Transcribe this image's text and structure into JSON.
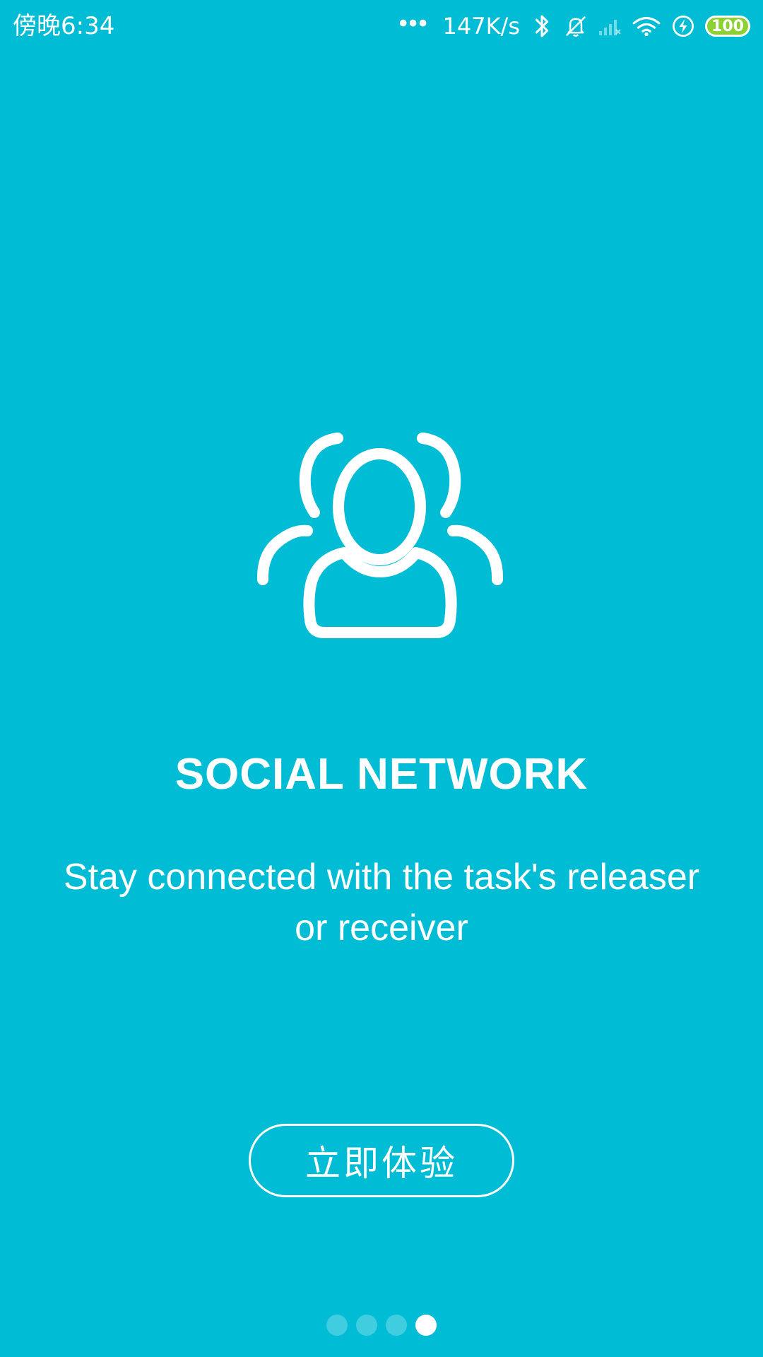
{
  "status_bar": {
    "time": "傍晚6:34",
    "more_indicator": "•••",
    "network_speed": "147K/s",
    "battery_level": "100",
    "battery_color": "#8bd12f",
    "icons": [
      "bluetooth-icon",
      "alarm-off-icon",
      "signal-icon",
      "wifi-icon",
      "charging-icon",
      "battery-icon"
    ]
  },
  "onboarding": {
    "title": "SOCIAL NETWORK",
    "description": "Stay connected with the task's releaser or receiver",
    "cta_label": "立即体验",
    "hero_icon": "users-group-icon"
  },
  "pager": {
    "total": 4,
    "active_index": 3
  },
  "colors": {
    "background": "#00BCD4",
    "foreground": "#FFFFFF"
  }
}
